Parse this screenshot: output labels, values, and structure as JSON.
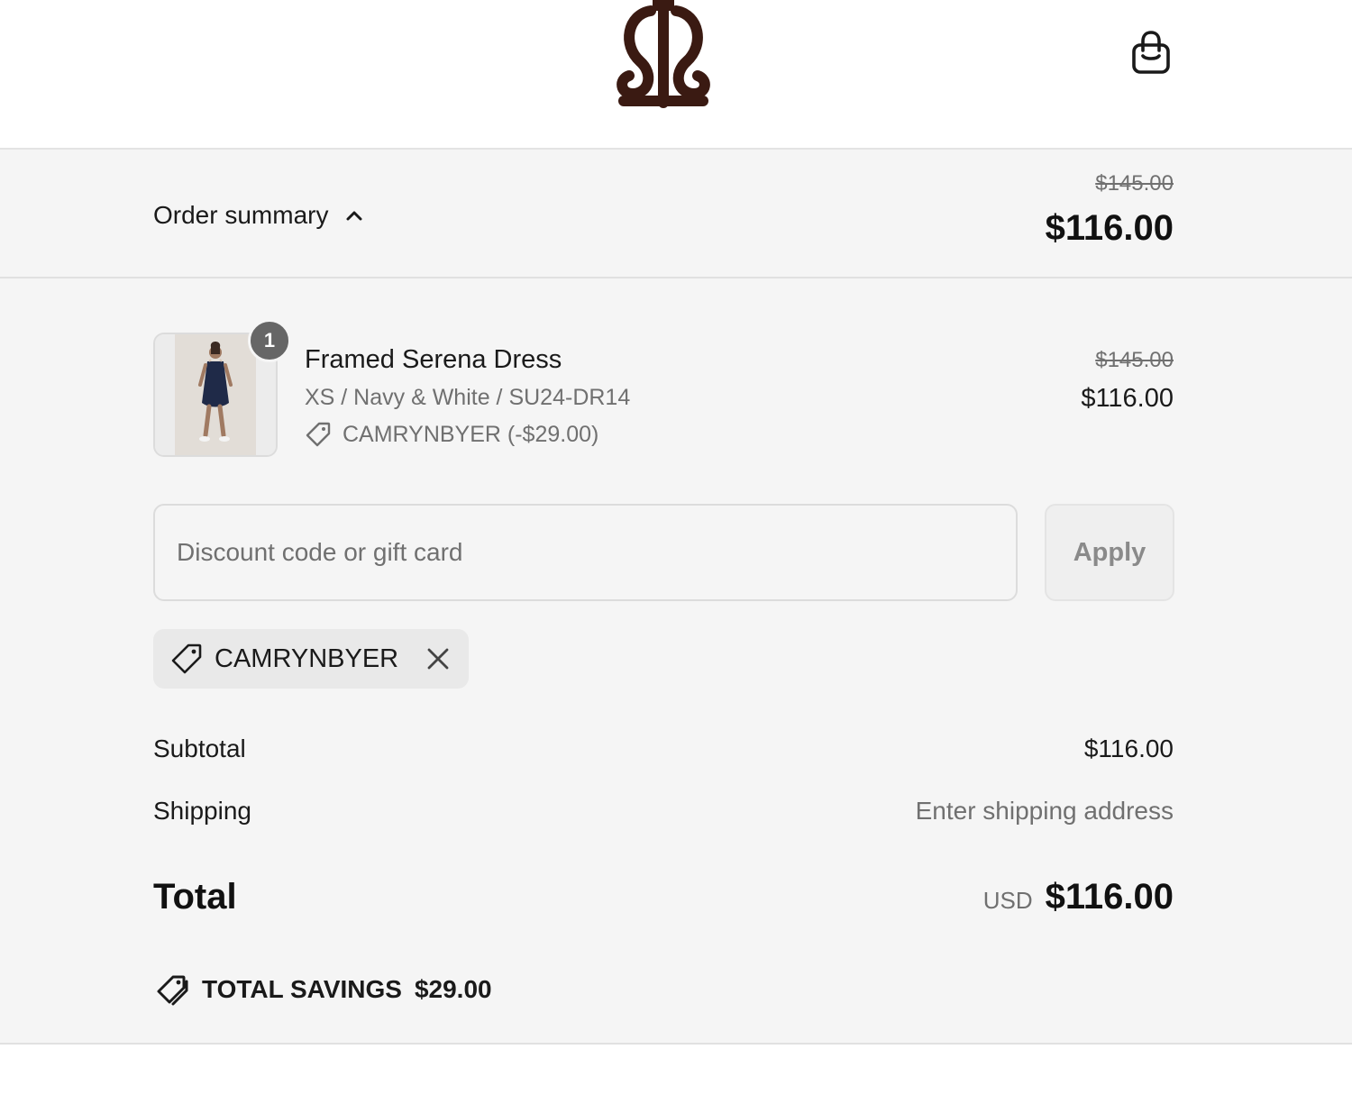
{
  "header": {
    "logo_icon": "scroll-ornament-logo",
    "cart_icon": "shopping-bag-icon"
  },
  "summary_bar": {
    "toggle_label": "Order summary",
    "toggle_icon": "chevron-up-icon",
    "original_total": "$145.00",
    "total": "$116.00"
  },
  "line_item": {
    "quantity": "1",
    "name": "Framed Serena Dress",
    "variant": "XS / Navy & White / SU24-DR14",
    "discount": "CAMRYNBYER (-$29.00)",
    "original_price": "$145.00",
    "price": "$116.00"
  },
  "discount_form": {
    "placeholder": "Discount code or gift card",
    "value": "",
    "apply_label": "Apply"
  },
  "applied_code": {
    "code": "CAMRYNBYER"
  },
  "totals": {
    "subtotal_label": "Subtotal",
    "subtotal_value": "$116.00",
    "shipping_label": "Shipping",
    "shipping_value": "Enter shipping address",
    "total_label": "Total",
    "currency": "USD",
    "total_value": "$116.00"
  },
  "savings": {
    "label": "TOTAL SAVINGS",
    "amount": "$29.00"
  },
  "colors": {
    "brand_logo": "#3a1a12",
    "panel_bg": "#f5f5f5",
    "muted_text": "#707070",
    "badge_bg": "#666666"
  }
}
